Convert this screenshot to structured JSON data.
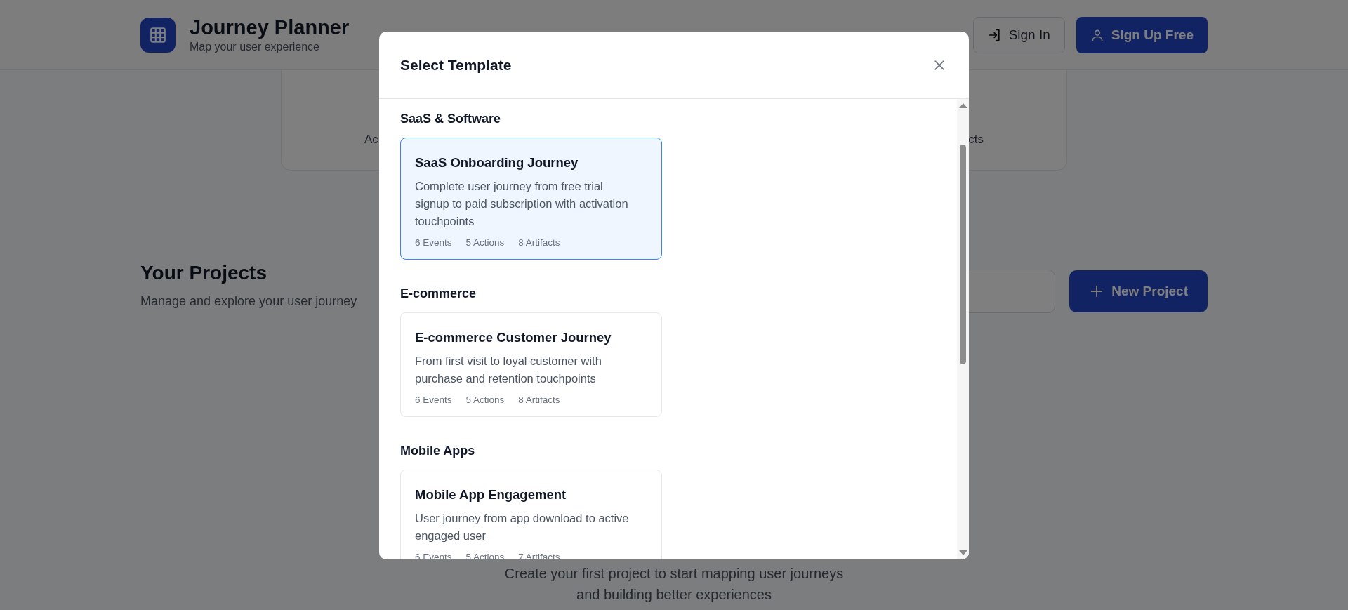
{
  "header": {
    "title": "Journey Planner",
    "subtitle": "Map your user experience",
    "buttons": [
      {
        "kind": "outline",
        "label": "Sign In"
      },
      {
        "kind": "primary",
        "label": "Sign Up Free"
      }
    ]
  },
  "stats": {
    "left_label": "Ac",
    "right_label": "cts"
  },
  "projects": {
    "title": "Your Projects",
    "subtitle": "Manage and explore your user journey",
    "new_button": "New Project"
  },
  "empty_state": {
    "lines": [
      "Create your first project to start mapping user journeys",
      "and building better experiences"
    ]
  },
  "modal": {
    "title": "Select Template",
    "sections": [
      {
        "heading": "SaaS & Software",
        "templates": [
          {
            "title": "SaaS Onboarding Journey",
            "description": "Complete user journey from free trial signup to paid subscription with activation touchpoints",
            "meta": [
              "6 Events",
              "5 Actions",
              "8 Artifacts"
            ],
            "selected": true
          }
        ]
      },
      {
        "heading": "E-commerce",
        "templates": [
          {
            "title": "E-commerce Customer Journey",
            "description": "From first visit to loyal customer with purchase and retention touchpoints",
            "meta": [
              "6 Events",
              "5 Actions",
              "8 Artifacts"
            ],
            "selected": false
          }
        ]
      },
      {
        "heading": "Mobile Apps",
        "templates": [
          {
            "title": "Mobile App Engagement",
            "description": "User journey from app download to active engaged user",
            "meta": [
              "6 Events",
              "5 Actions",
              "7 Artifacts"
            ],
            "selected": false
          }
        ]
      }
    ]
  }
}
